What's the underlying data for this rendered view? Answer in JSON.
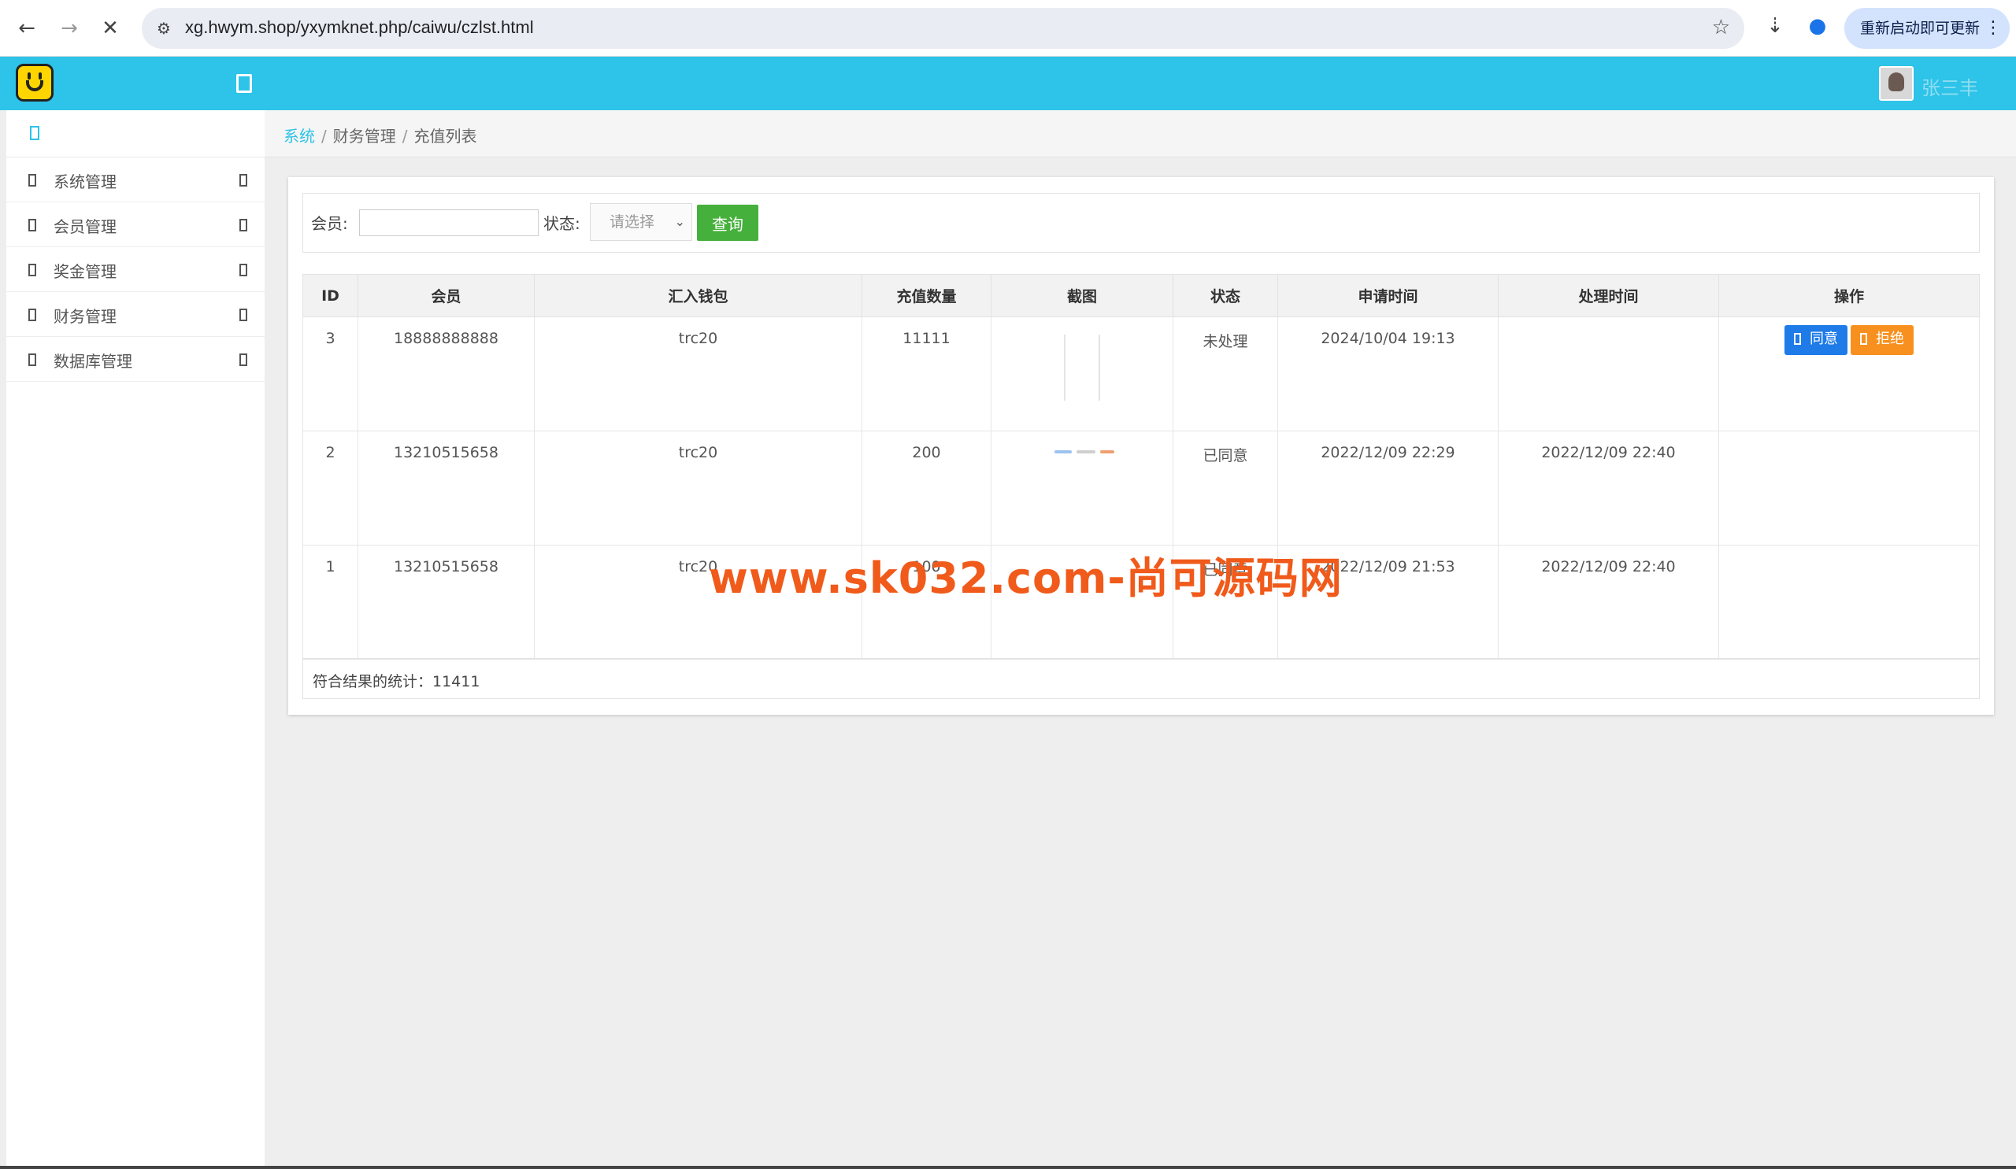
{
  "browser": {
    "url": "xg.hwym.shop/yxymknet.php/caiwu/czlst.html",
    "update_label": "重新启动即可更新",
    "back_icon": "arrow-left-icon",
    "forward_icon": "arrow-right-icon",
    "stop_icon": "close-icon"
  },
  "header": {
    "username": "张三丰"
  },
  "sidebar": {
    "items": [
      {
        "label": "系统管理"
      },
      {
        "label": "会员管理"
      },
      {
        "label": "奖金管理"
      },
      {
        "label": "财务管理"
      },
      {
        "label": "数据库管理"
      }
    ]
  },
  "breadcrumb": {
    "items": [
      "系统",
      "财务管理",
      "充值列表"
    ]
  },
  "filter": {
    "member_label": "会员:",
    "member_value": "",
    "status_label": "状态:",
    "status_selected": "请选择",
    "query_label": "查询"
  },
  "table": {
    "headers": [
      "ID",
      "会员",
      "汇入钱包",
      "充值数量",
      "截图",
      "状态",
      "申请时间",
      "处理时间",
      "操作"
    ],
    "rows": [
      {
        "id": "3",
        "member": "18888888888",
        "wallet": "trc20",
        "amount": "11111",
        "status": "未处理",
        "apply_time": "2024/10/04 19:13",
        "process_time": "",
        "actions": [
          "同意",
          "拒绝"
        ]
      },
      {
        "id": "2",
        "member": "13210515658",
        "wallet": "trc20",
        "amount": "200",
        "status": "已同意",
        "apply_time": "2022/12/09 22:29",
        "process_time": "2022/12/09 22:40",
        "actions": []
      },
      {
        "id": "1",
        "member": "13210515658",
        "wallet": "trc20",
        "amount": "100",
        "status": "已同意",
        "apply_time": "2022/12/09 21:53",
        "process_time": "2022/12/09 22:40",
        "actions": []
      }
    ]
  },
  "summary": {
    "text": "符合结果的统计：11411"
  },
  "watermark": "www.sk032.com-尚可源码网",
  "colors": {
    "header": "#2ec3e8",
    "query_button": "#46b03c",
    "agree_button": "#1e7be8",
    "reject_button": "#f7901e",
    "watermark": "#f05a1a"
  }
}
